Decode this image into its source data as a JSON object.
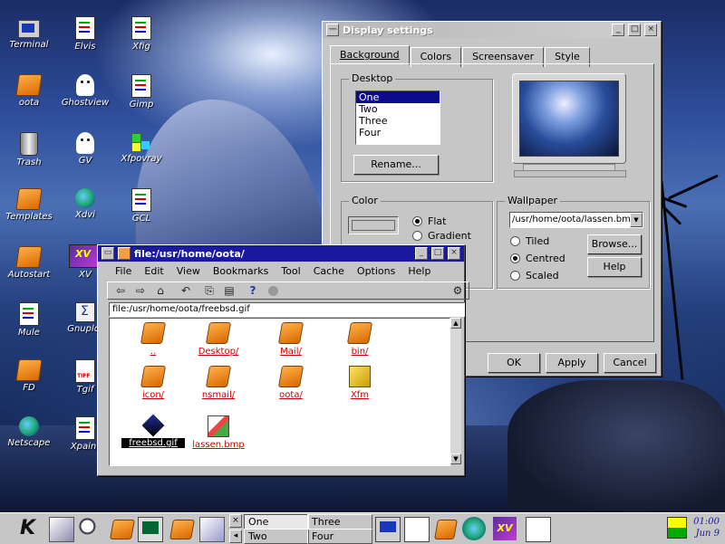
{
  "desktop_icons": [
    {
      "label": "Terminal",
      "icon": "terminal-icon"
    },
    {
      "label": "oota",
      "icon": "folder-icon"
    },
    {
      "label": "Trash",
      "icon": "trash-icon"
    },
    {
      "label": "Templates",
      "icon": "folder-icon"
    },
    {
      "label": "Autostart",
      "icon": "folder-icon"
    },
    {
      "label": "Mule",
      "icon": "document-icon"
    },
    {
      "label": "FD",
      "icon": "folder-icon"
    },
    {
      "label": "Netscape",
      "icon": "globe-icon"
    },
    {
      "label": "Elvis",
      "icon": "editor-icon"
    },
    {
      "label": "Ghostview",
      "icon": "ghost-icon"
    },
    {
      "label": "GV",
      "icon": "ghost-icon"
    },
    {
      "label": "Xdvi",
      "icon": "dvi-icon"
    },
    {
      "label": "XV",
      "icon": "xv-icon"
    },
    {
      "label": "Gnuplot",
      "icon": "sigma-icon"
    },
    {
      "label": "Tgif",
      "icon": "tiff-icon"
    },
    {
      "label": "Xpaint",
      "icon": "paint-icon"
    },
    {
      "label": "Xfig",
      "icon": "xfig-icon"
    },
    {
      "label": "Gimp",
      "icon": "gimp-icon"
    },
    {
      "label": "Xfpovray",
      "icon": "blocks-icon"
    },
    {
      "label": "GCL",
      "icon": "gcl-icon"
    }
  ],
  "display_settings": {
    "title": "Display settings",
    "tabs": [
      {
        "label": "Background",
        "active": true
      },
      {
        "label": "Colors",
        "active": false
      },
      {
        "label": "Screensaver",
        "active": false
      },
      {
        "label": "Style",
        "active": false
      }
    ],
    "desktop_group": {
      "title": "Desktop",
      "items": [
        "One",
        "Two",
        "Three",
        "Four"
      ],
      "selected": "One",
      "rename_button": "Rename..."
    },
    "color_group": {
      "title": "Color",
      "options": [
        "Flat",
        "Gradient"
      ],
      "selected": "Flat"
    },
    "wallpaper_group": {
      "title": "Wallpaper",
      "file": "/usr/home/oota/lassen.bmp",
      "options": [
        "Tiled",
        "Centred",
        "Scaled"
      ],
      "selected": "Centred",
      "browse_button": "Browse...",
      "help_button": "Help"
    },
    "buttons": {
      "ok": "OK",
      "apply": "Apply",
      "cancel": "Cancel"
    }
  },
  "file_manager": {
    "title": "file:/usr/home/oota/",
    "menu": [
      "File",
      "Edit",
      "View",
      "Bookmarks",
      "Tool",
      "Cache",
      "Options",
      "Help"
    ],
    "toolbar_icons": [
      "back-icon",
      "forward-icon",
      "home-icon",
      "reload-icon",
      "copy-icon",
      "paste-icon",
      "help-icon",
      "stop-icon",
      "gear-icon"
    ],
    "location": "file:/usr/home/oota/freebsd.gif",
    "files": [
      {
        "name": "..",
        "type": "folder"
      },
      {
        "name": "Desktop/",
        "type": "folder"
      },
      {
        "name": "Mail/",
        "type": "folder"
      },
      {
        "name": "bin/",
        "type": "folder"
      },
      {
        "name": "icon/",
        "type": "folder"
      },
      {
        "name": "nsmail/",
        "type": "folder"
      },
      {
        "name": "oota/",
        "type": "folder"
      },
      {
        "name": "Xfm",
        "type": "app"
      },
      {
        "name": "freebsd.gif",
        "type": "image",
        "selected": true
      },
      {
        "name": "lassen.bmp",
        "type": "image"
      }
    ]
  },
  "taskbar": {
    "pager": [
      "One",
      "Three",
      "Two",
      "Four"
    ],
    "clock_time": "01:00",
    "clock_date": "Jun 9"
  }
}
